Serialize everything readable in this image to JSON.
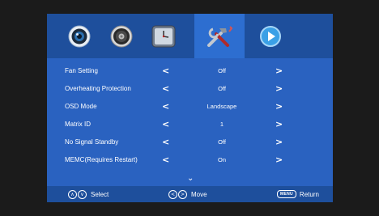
{
  "tabs": [
    {
      "icon": "picture-lens-icon",
      "selected": false
    },
    {
      "icon": "speaker-icon",
      "selected": false
    },
    {
      "icon": "clock-icon",
      "selected": false
    },
    {
      "icon": "tools-icon",
      "selected": true
    },
    {
      "icon": "play-icon",
      "selected": false
    }
  ],
  "rows": [
    {
      "label": "Fan Setting",
      "value": "Off"
    },
    {
      "label": "Overheating Protection",
      "value": "Off"
    },
    {
      "label": "OSD Mode",
      "value": "Landscape"
    },
    {
      "label": "Matrix ID",
      "value": "1"
    },
    {
      "label": "No Signal Standby",
      "value": "Off"
    },
    {
      "label": "MEMC(Requires Restart)",
      "value": "On"
    }
  ],
  "arrows": {
    "left": "<",
    "right": ">",
    "down": "⌄"
  },
  "footer": {
    "select_label": "Select",
    "move_label": "Move",
    "menu_key": "MENU",
    "return_label": "Return"
  },
  "colors": {
    "menu_bg": "#2a62c0",
    "header_bg": "#1e4f9c",
    "selected_tab": "#2d6ed0",
    "text": "#ffffff"
  }
}
